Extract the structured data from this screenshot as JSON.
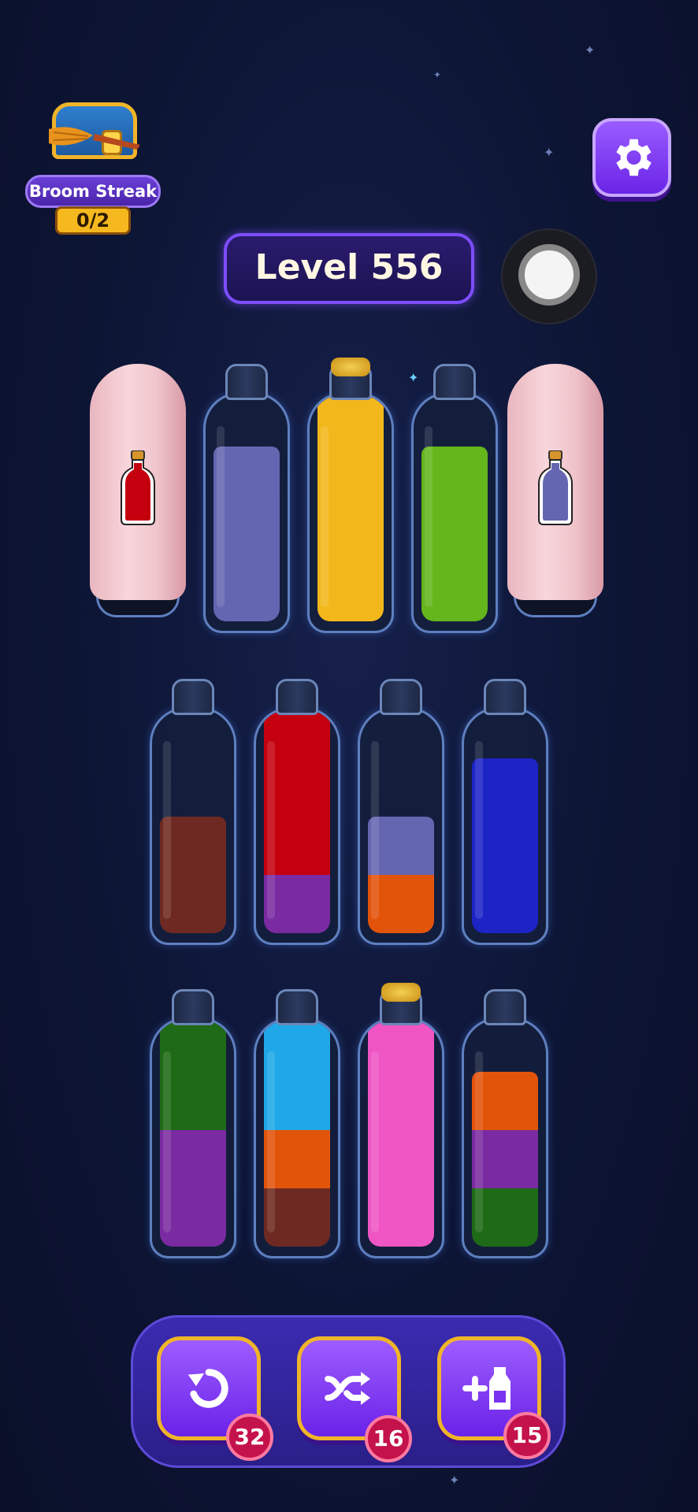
{
  "streak": {
    "label": "Broom Streak",
    "count": "0/2"
  },
  "level": {
    "label": "Level 556"
  },
  "colors": {
    "red": "#c4000f",
    "periwinkle": "#6566b1",
    "yellow": "#f2b81b",
    "lime": "#65b51c",
    "brown": "#6e2a22",
    "purple": "#7a2ba1",
    "orange": "#e3540b",
    "blue": "#1d24c6",
    "green": "#1e6a16",
    "cyan": "#1fa8e8",
    "pink": "#f055c4"
  },
  "rows": [
    {
      "bottles": [
        {
          "covered": true,
          "hint": "red"
        },
        {
          "layers": [
            "periwinkle",
            "periwinkle",
            "periwinkle"
          ]
        },
        {
          "layers": [
            "yellow",
            "yellow",
            "yellow",
            "yellow"
          ],
          "corked": true
        },
        {
          "layers": [
            "lime",
            "lime",
            "lime"
          ]
        },
        {
          "covered": true,
          "hint": "periwinkle"
        }
      ]
    },
    {
      "bottles": [
        {
          "layers": [
            "brown",
            "brown"
          ]
        },
        {
          "layers": [
            "purple",
            "red",
            "red",
            "red"
          ]
        },
        {
          "layers": [
            "orange",
            "periwinkle"
          ]
        },
        {
          "layers": [
            "blue",
            "blue",
            "blue"
          ]
        }
      ]
    },
    {
      "bottles": [
        {
          "layers": [
            "purple",
            "purple",
            "green",
            "green"
          ]
        },
        {
          "layers": [
            "brown",
            "orange",
            "cyan",
            "cyan"
          ]
        },
        {
          "layers": [
            "pink",
            "pink",
            "pink",
            "pink"
          ],
          "corked": true
        },
        {
          "layers": [
            "green",
            "purple",
            "orange"
          ]
        }
      ]
    }
  ],
  "tools": [
    {
      "name": "undo",
      "count": "32"
    },
    {
      "name": "shuffle",
      "count": "16"
    },
    {
      "name": "add-bottle",
      "count": "15"
    }
  ]
}
